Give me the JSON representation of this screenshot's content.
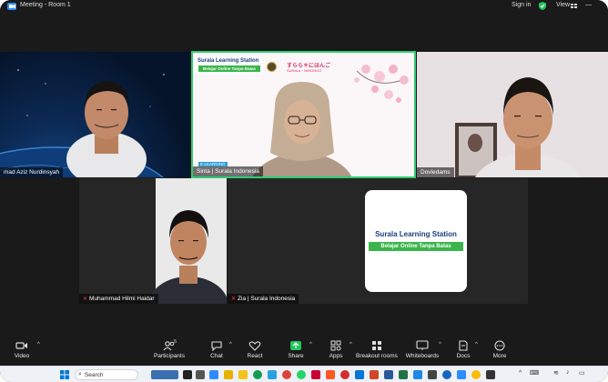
{
  "window": {
    "title": "Meeting - Room 1",
    "signin_label": "Sign in",
    "view_label": "View"
  },
  "participants": [
    {
      "name": "mad Aziz Nurdinsyah",
      "muted": false
    },
    {
      "name": "Sinta | Surala Indonesia",
      "muted": false
    },
    {
      "name": "Dovledams",
      "muted": false
    },
    {
      "name": "Muhammad Hilmi Haidar",
      "muted": true
    },
    {
      "name": "Zia | Surala Indonesia",
      "muted": true
    }
  ],
  "slide": {
    "brand": "Surala Learning Station",
    "tagline": "Belajar Online Tanpa Batas",
    "japanese": "すらら＊にほんご",
    "japanese_sub": "SURaLa・NIHONGO",
    "badge": "E-LEARNING"
  },
  "share_card": {
    "brand": "Surala Learning Station",
    "tagline": "Belajar Online Tanpa Batas"
  },
  "toolbar": {
    "video": "Video",
    "participants": "Participants",
    "participants_count": "5",
    "chat": "Chat",
    "react": "React",
    "share": "Share",
    "apps": "Apps",
    "breakout": "Breakout rooms",
    "whiteboards": "Whiteboards",
    "docs": "Docs",
    "more": "More"
  },
  "taskbar": {
    "search_placeholder": "Search"
  },
  "colors": {
    "share_green": "#23c45e",
    "active_border": "#2ecc71",
    "toolbar_bg": "#1a1a1a",
    "muted_red": "#ff3b3b"
  }
}
